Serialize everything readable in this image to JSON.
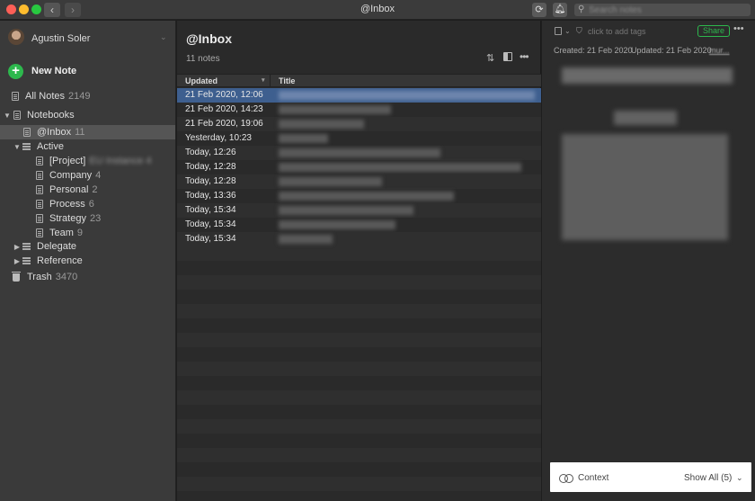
{
  "window": {
    "title": "@Inbox"
  },
  "toolbar": {
    "back": "‹",
    "forward": "›",
    "sync_icon": "sync-icon",
    "notification_icon": "bell-icon",
    "search_placeholder": "Search notes"
  },
  "sidebar": {
    "user_name": "Agustin Soler",
    "new_note": "New Note",
    "all_notes": {
      "label": "All Notes",
      "count": "2149"
    },
    "notebooks": {
      "label": "Notebooks"
    },
    "inbox": {
      "label": "@Inbox",
      "count": "11"
    },
    "active": {
      "label": "Active"
    },
    "active_items": [
      {
        "label": "[Project]",
        "count": "EU Instance 4"
      },
      {
        "label": "Company",
        "count": "4"
      },
      {
        "label": "Personal",
        "count": "2"
      },
      {
        "label": "Process",
        "count": "6"
      },
      {
        "label": "Strategy",
        "count": "23"
      },
      {
        "label": "Team",
        "count": "9"
      }
    ],
    "delegate": {
      "label": "Delegate"
    },
    "reference": {
      "label": "Reference"
    },
    "trash": {
      "label": "Trash",
      "count": "3470"
    }
  },
  "notes_list": {
    "title": "@Inbox",
    "count_text": "11 notes",
    "columns": {
      "updated": "Updated",
      "title": "Title"
    },
    "rows": [
      {
        "updated": "21 Feb 2020, 12:06"
      },
      {
        "updated": "21 Feb 2020, 14:23"
      },
      {
        "updated": "21 Feb 2020, 19:06"
      },
      {
        "updated": "Yesterday, 10:23"
      },
      {
        "updated": "Today, 12:26"
      },
      {
        "updated": "Today, 12:28"
      },
      {
        "updated": "Today, 12:28"
      },
      {
        "updated": "Today, 13:36"
      },
      {
        "updated": "Today, 15:34"
      },
      {
        "updated": "Today, 15:34"
      },
      {
        "updated": "Today, 15:34"
      }
    ]
  },
  "note_pane": {
    "tags_placeholder": "click to add tags",
    "share": "Share",
    "created": "Created: 21 Feb 2020",
    "updated": "Updated: 21 Feb 2020",
    "link": "mur...",
    "context_label": "Context",
    "show_all": "Show All (5)"
  },
  "colors": {
    "accent_green": "#2db84d",
    "selection_blue": "#3e5f8f",
    "sidebar_bg": "#3a3a3a"
  }
}
